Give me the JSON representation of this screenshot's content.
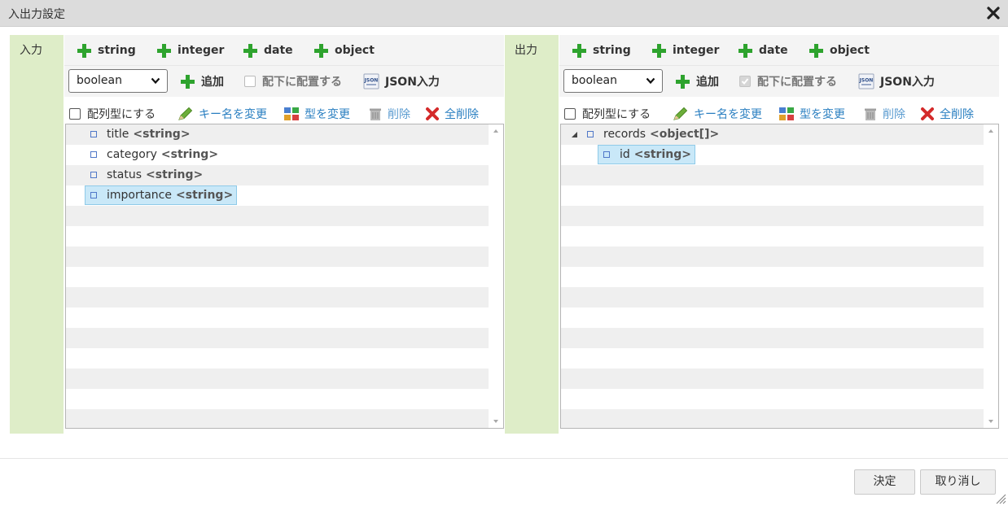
{
  "dialog": {
    "title": "入出力設定"
  },
  "input": {
    "label": "入力",
    "type_buttons": [
      "string",
      "integer",
      "date",
      "object"
    ],
    "select_value": "boolean",
    "add_label": "追加",
    "nest_label": "配下に配置する",
    "json_label": "JSON入力",
    "array_label": "配列型にする",
    "rename_label": "キー名を変更",
    "change_type_label": "型を変更",
    "delete_label": "削除",
    "delete_all_label": "全削除",
    "nodes": [
      {
        "name": "title",
        "type": "<string>"
      },
      {
        "name": "category",
        "type": "<string>"
      },
      {
        "name": "status",
        "type": "<string>"
      },
      {
        "name": "importance",
        "type": "<string>"
      }
    ]
  },
  "output": {
    "label": "出力",
    "type_buttons": [
      "string",
      "integer",
      "date",
      "object"
    ],
    "select_value": "boolean",
    "add_label": "追加",
    "nest_label": "配下に配置する",
    "json_label": "JSON入力",
    "array_label": "配列型にする",
    "rename_label": "キー名を変更",
    "change_type_label": "型を変更",
    "delete_label": "削除",
    "delete_all_label": "全削除",
    "nodes": [
      {
        "name": "records",
        "type": "<object[]>"
      },
      {
        "name": "id",
        "type": "<string>"
      }
    ]
  },
  "footer": {
    "ok_label": "決定",
    "cancel_label": "取り消し"
  },
  "colors": {
    "side_label_bg": "#deedc8",
    "plus_icon": "#2ea32e",
    "link": "#2a7fc1",
    "selected_bg": "#c9e8f8"
  }
}
